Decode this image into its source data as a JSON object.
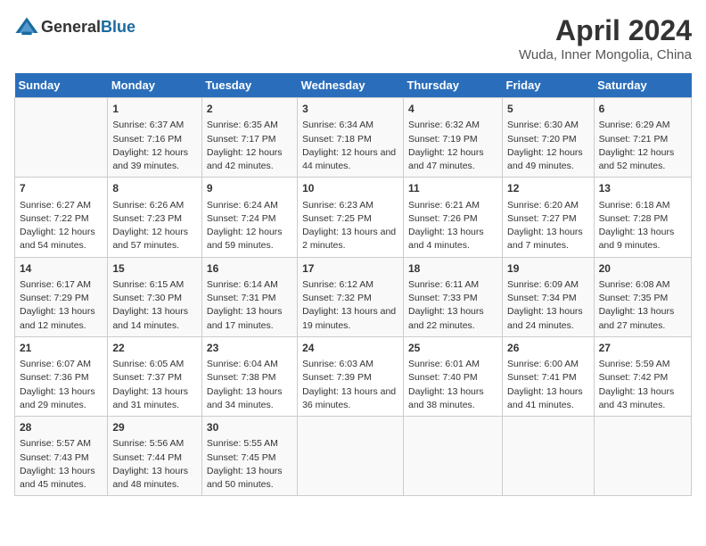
{
  "logo": {
    "general": "General",
    "blue": "Blue"
  },
  "title": "April 2024",
  "subtitle": "Wuda, Inner Mongolia, China",
  "header_days": [
    "Sunday",
    "Monday",
    "Tuesday",
    "Wednesday",
    "Thursday",
    "Friday",
    "Saturday"
  ],
  "weeks": [
    [
      {
        "day": "",
        "sunrise": "",
        "sunset": "",
        "daylight": "",
        "empty": true
      },
      {
        "day": "1",
        "sunrise": "6:37 AM",
        "sunset": "7:16 PM",
        "daylight": "12 hours and 39 minutes."
      },
      {
        "day": "2",
        "sunrise": "6:35 AM",
        "sunset": "7:17 PM",
        "daylight": "12 hours and 42 minutes."
      },
      {
        "day": "3",
        "sunrise": "6:34 AM",
        "sunset": "7:18 PM",
        "daylight": "12 hours and 44 minutes."
      },
      {
        "day": "4",
        "sunrise": "6:32 AM",
        "sunset": "7:19 PM",
        "daylight": "12 hours and 47 minutes."
      },
      {
        "day": "5",
        "sunrise": "6:30 AM",
        "sunset": "7:20 PM",
        "daylight": "12 hours and 49 minutes."
      },
      {
        "day": "6",
        "sunrise": "6:29 AM",
        "sunset": "7:21 PM",
        "daylight": "12 hours and 52 minutes."
      }
    ],
    [
      {
        "day": "7",
        "sunrise": "6:27 AM",
        "sunset": "7:22 PM",
        "daylight": "12 hours and 54 minutes."
      },
      {
        "day": "8",
        "sunrise": "6:26 AM",
        "sunset": "7:23 PM",
        "daylight": "12 hours and 57 minutes."
      },
      {
        "day": "9",
        "sunrise": "6:24 AM",
        "sunset": "7:24 PM",
        "daylight": "12 hours and 59 minutes."
      },
      {
        "day": "10",
        "sunrise": "6:23 AM",
        "sunset": "7:25 PM",
        "daylight": "13 hours and 2 minutes."
      },
      {
        "day": "11",
        "sunrise": "6:21 AM",
        "sunset": "7:26 PM",
        "daylight": "13 hours and 4 minutes."
      },
      {
        "day": "12",
        "sunrise": "6:20 AM",
        "sunset": "7:27 PM",
        "daylight": "13 hours and 7 minutes."
      },
      {
        "day": "13",
        "sunrise": "6:18 AM",
        "sunset": "7:28 PM",
        "daylight": "13 hours and 9 minutes."
      }
    ],
    [
      {
        "day": "14",
        "sunrise": "6:17 AM",
        "sunset": "7:29 PM",
        "daylight": "13 hours and 12 minutes."
      },
      {
        "day": "15",
        "sunrise": "6:15 AM",
        "sunset": "7:30 PM",
        "daylight": "13 hours and 14 minutes."
      },
      {
        "day": "16",
        "sunrise": "6:14 AM",
        "sunset": "7:31 PM",
        "daylight": "13 hours and 17 minutes."
      },
      {
        "day": "17",
        "sunrise": "6:12 AM",
        "sunset": "7:32 PM",
        "daylight": "13 hours and 19 minutes."
      },
      {
        "day": "18",
        "sunrise": "6:11 AM",
        "sunset": "7:33 PM",
        "daylight": "13 hours and 22 minutes."
      },
      {
        "day": "19",
        "sunrise": "6:09 AM",
        "sunset": "7:34 PM",
        "daylight": "13 hours and 24 minutes."
      },
      {
        "day": "20",
        "sunrise": "6:08 AM",
        "sunset": "7:35 PM",
        "daylight": "13 hours and 27 minutes."
      }
    ],
    [
      {
        "day": "21",
        "sunrise": "6:07 AM",
        "sunset": "7:36 PM",
        "daylight": "13 hours and 29 minutes."
      },
      {
        "day": "22",
        "sunrise": "6:05 AM",
        "sunset": "7:37 PM",
        "daylight": "13 hours and 31 minutes."
      },
      {
        "day": "23",
        "sunrise": "6:04 AM",
        "sunset": "7:38 PM",
        "daylight": "13 hours and 34 minutes."
      },
      {
        "day": "24",
        "sunrise": "6:03 AM",
        "sunset": "7:39 PM",
        "daylight": "13 hours and 36 minutes."
      },
      {
        "day": "25",
        "sunrise": "6:01 AM",
        "sunset": "7:40 PM",
        "daylight": "13 hours and 38 minutes."
      },
      {
        "day": "26",
        "sunrise": "6:00 AM",
        "sunset": "7:41 PM",
        "daylight": "13 hours and 41 minutes."
      },
      {
        "day": "27",
        "sunrise": "5:59 AM",
        "sunset": "7:42 PM",
        "daylight": "13 hours and 43 minutes."
      }
    ],
    [
      {
        "day": "28",
        "sunrise": "5:57 AM",
        "sunset": "7:43 PM",
        "daylight": "13 hours and 45 minutes."
      },
      {
        "day": "29",
        "sunrise": "5:56 AM",
        "sunset": "7:44 PM",
        "daylight": "13 hours and 48 minutes."
      },
      {
        "day": "30",
        "sunrise": "5:55 AM",
        "sunset": "7:45 PM",
        "daylight": "13 hours and 50 minutes."
      },
      {
        "day": "",
        "sunrise": "",
        "sunset": "",
        "daylight": "",
        "empty": true
      },
      {
        "day": "",
        "sunrise": "",
        "sunset": "",
        "daylight": "",
        "empty": true
      },
      {
        "day": "",
        "sunrise": "",
        "sunset": "",
        "daylight": "",
        "empty": true
      },
      {
        "day": "",
        "sunrise": "",
        "sunset": "",
        "daylight": "",
        "empty": true
      }
    ]
  ],
  "labels": {
    "sunrise": "Sunrise:",
    "sunset": "Sunset:",
    "daylight": "Daylight:"
  }
}
